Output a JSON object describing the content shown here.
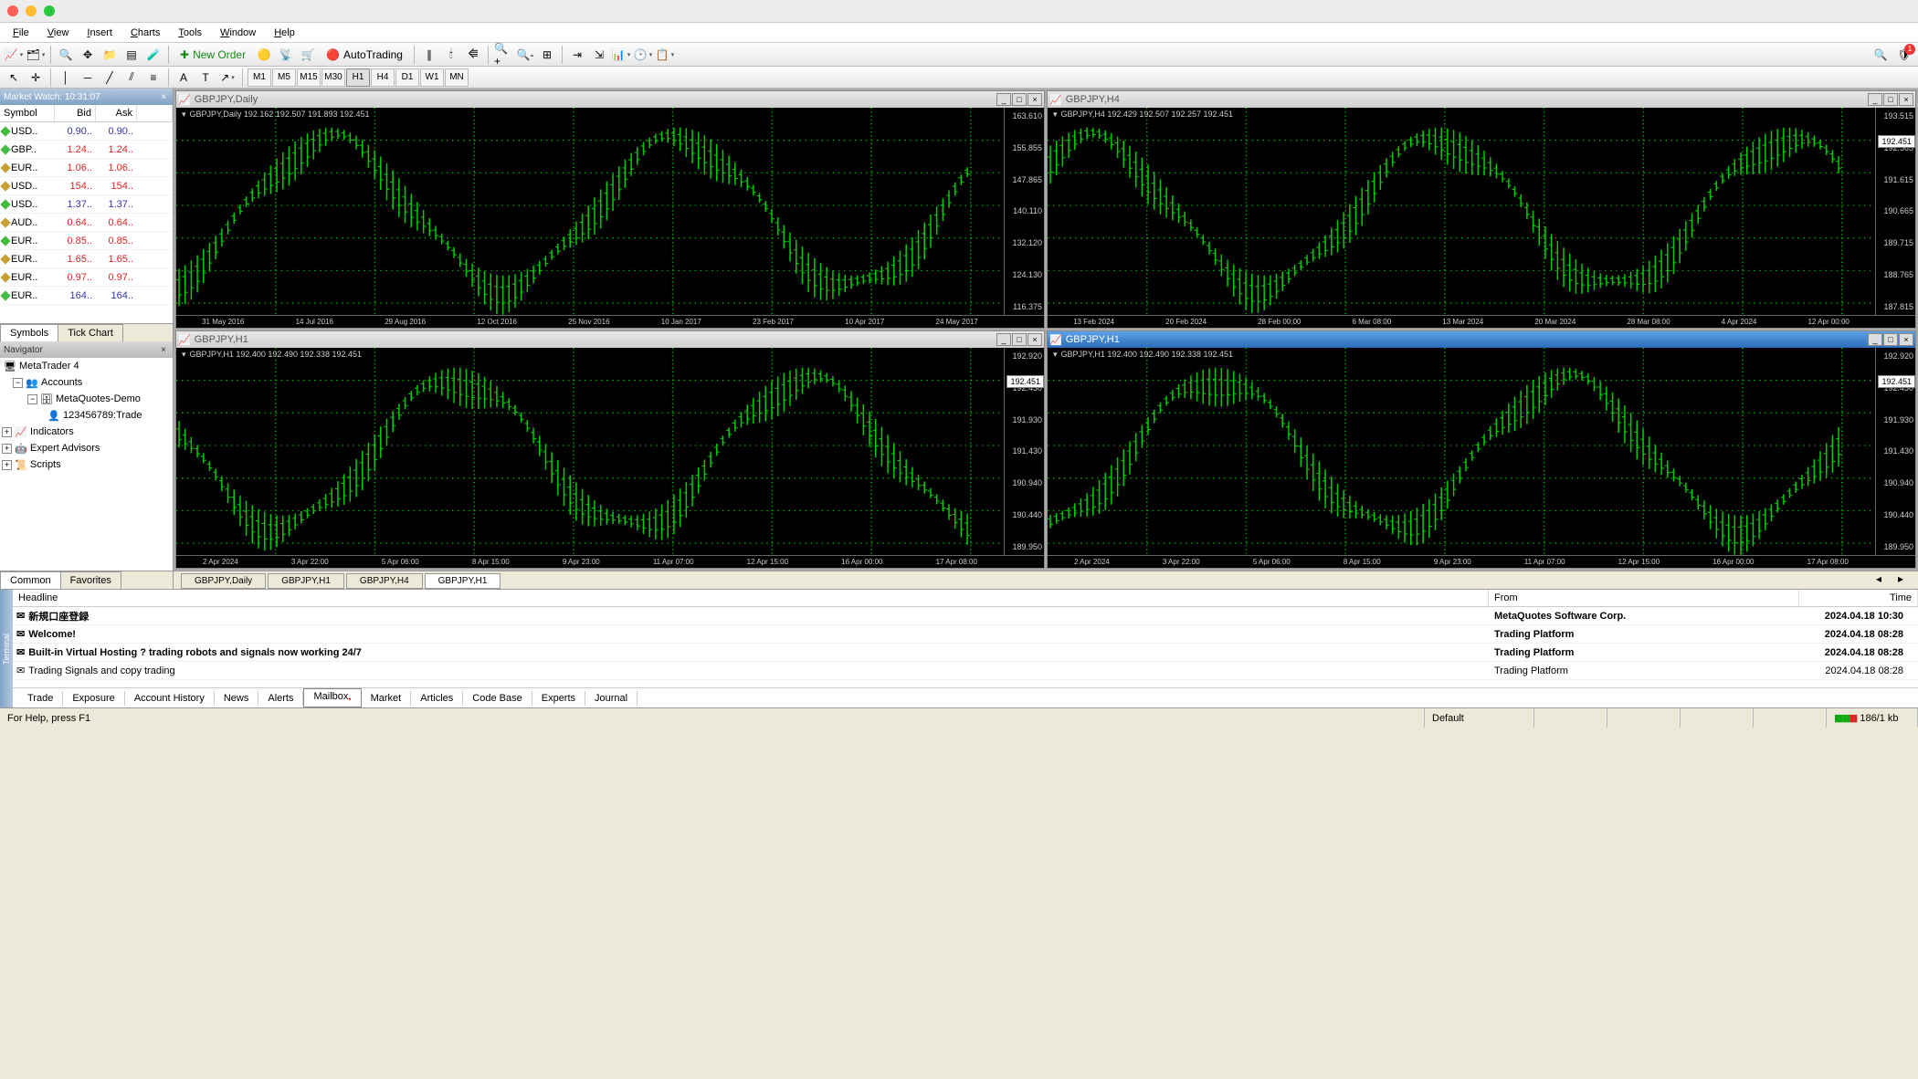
{
  "menu": [
    "File",
    "View",
    "Insert",
    "Charts",
    "Tools",
    "Window",
    "Help"
  ],
  "toolbar": {
    "new_order": "New Order",
    "autotrading": "AutoTrading",
    "notif_count": "1"
  },
  "timeframes": [
    "M1",
    "M5",
    "M15",
    "M30",
    "H1",
    "H4",
    "D1",
    "W1",
    "MN"
  ],
  "tf_active": "H1",
  "market_watch": {
    "title": "Market Watch: 10:31:07",
    "cols": [
      "Symbol",
      "Bid",
      "Ask"
    ],
    "rows": [
      {
        "sym": "USD..",
        "bid": "0.90..",
        "ask": "0.90..",
        "cb": "#33a",
        "ca": "#33a",
        "d": "#4b4"
      },
      {
        "sym": "GBP..",
        "bid": "1.24..",
        "ask": "1.24..",
        "cb": "#d22",
        "ca": "#d22",
        "d": "#4b4"
      },
      {
        "sym": "EUR..",
        "bid": "1.06..",
        "ask": "1.06..",
        "cb": "#d22",
        "ca": "#d22",
        "d": "#c8a030"
      },
      {
        "sym": "USD..",
        "bid": "154..",
        "ask": "154..",
        "cb": "#d22",
        "ca": "#d22",
        "d": "#c8a030"
      },
      {
        "sym": "USD..",
        "bid": "1.37..",
        "ask": "1.37..",
        "cb": "#33a",
        "ca": "#33a",
        "d": "#4b4"
      },
      {
        "sym": "AUD..",
        "bid": "0.64..",
        "ask": "0.64..",
        "cb": "#d22",
        "ca": "#d22",
        "d": "#c8a030"
      },
      {
        "sym": "EUR..",
        "bid": "0.85..",
        "ask": "0.85..",
        "cb": "#d22",
        "ca": "#d22",
        "d": "#4b4"
      },
      {
        "sym": "EUR..",
        "bid": "1.65..",
        "ask": "1.65..",
        "cb": "#d22",
        "ca": "#d22",
        "d": "#c8a030"
      },
      {
        "sym": "EUR..",
        "bid": "0.97..",
        "ask": "0.97..",
        "cb": "#d22",
        "ca": "#d22",
        "d": "#c8a030"
      },
      {
        "sym": "EUR..",
        "bid": "164..",
        "ask": "164..",
        "cb": "#33a",
        "ca": "#33a",
        "d": "#4b4"
      }
    ],
    "tabs": [
      "Symbols",
      "Tick Chart"
    ]
  },
  "navigator": {
    "title": "Navigator",
    "root": "MetaTrader 4",
    "accounts": "Accounts",
    "demo": "MetaQuotes-Demo",
    "user": "123456789:Trade",
    "indicators": "Indicators",
    "experts": "Expert Advisors",
    "scripts": "Scripts",
    "tabs": [
      "Common",
      "Favorites"
    ]
  },
  "charts_list": [
    {
      "title": "GBPJPY,Daily",
      "label": "GBPJPY,Daily  192.162 192.507 191.893 192.451",
      "ylabels": [
        "163.610",
        "155.855",
        "147.865",
        "140.110",
        "132.120",
        "124.130",
        "116.375"
      ],
      "xlabels": [
        "31 May 2016",
        "14 Jul 2016",
        "29 Aug 2016",
        "12 Oct 2016",
        "25 Nov 2016",
        "10 Jan 2017",
        "23 Feb 2017",
        "10 Apr 2017",
        "24 May 2017"
      ],
      "active": false
    },
    {
      "title": "GBPJPY,H4",
      "label": "GBPJPY,H4  192.429 192.507 192.257 192.451",
      "ylabels": [
        "193.515",
        "192.565",
        "191.615",
        "190.665",
        "189.715",
        "188.765",
        "187.815"
      ],
      "tag": "192.451",
      "xlabels": [
        "13 Feb 2024",
        "20 Feb 2024",
        "28 Feb 00:00",
        "6 Mar 08:00",
        "13 Mar 2024",
        "20 Mar 2024",
        "28 Mar 08:00",
        "4 Apr 2024",
        "12 Apr 00:00"
      ],
      "active": false
    },
    {
      "title": "GBPJPY,H1",
      "label": "GBPJPY,H1  192.400 192.490 192.338 192.451",
      "ylabels": [
        "192.920",
        "192.430",
        "191.930",
        "191.430",
        "190.940",
        "190.440",
        "189.950"
      ],
      "tag": "192.451",
      "xlabels": [
        "2 Apr 2024",
        "3 Apr 22:00",
        "5 Apr 06:00",
        "8 Apr 15:00",
        "9 Apr 23:00",
        "11 Apr 07:00",
        "12 Apr 15:00",
        "16 Apr 00:00",
        "17 Apr 08:00"
      ],
      "active": false
    },
    {
      "title": "GBPJPY,H1",
      "label": "GBPJPY,H1  192.400 192.490 192.338 192.451",
      "ylabels": [
        "192.920",
        "192.430",
        "191.930",
        "191.430",
        "190.940",
        "190.440",
        "189.950"
      ],
      "tag": "192.451",
      "xlabels": [
        "2 Apr 2024",
        "3 Apr 22:00",
        "5 Apr 06:00",
        "8 Apr 15:00",
        "9 Apr 23:00",
        "11 Apr 07:00",
        "12 Apr 15:00",
        "16 Apr 00:00",
        "17 Apr 08:00"
      ],
      "active": true
    }
  ],
  "chart_tabs": [
    "GBPJPY,Daily",
    "GBPJPY,H1",
    "GBPJPY,H4",
    "GBPJPY,H1"
  ],
  "chart_tab_active": 3,
  "terminal": {
    "side": "Terminal",
    "cols": [
      "Headline",
      "From",
      "Time"
    ],
    "rows": [
      {
        "h": "新規口座登録",
        "f": "MetaQuotes Software Corp.",
        "t": "2024.04.18 10:30",
        "bold": true
      },
      {
        "h": "Welcome!",
        "f": "Trading Platform",
        "t": "2024.04.18 08:28",
        "bold": true
      },
      {
        "h": "Built-in Virtual Hosting ? trading robots and signals now working 24/7",
        "f": "Trading Platform",
        "t": "2024.04.18 08:28",
        "bold": true
      },
      {
        "h": "Trading Signals and copy trading",
        "f": "Trading Platform",
        "t": "2024.04.18 08:28",
        "bold": false
      }
    ],
    "tabs": [
      "Trade",
      "Exposure",
      "Account History",
      "News",
      "Alerts",
      "Mailbox",
      "Market",
      "Articles",
      "Code Base",
      "Experts",
      "Journal"
    ],
    "tab_active": 5
  },
  "status": {
    "help": "For Help, press F1",
    "profile": "Default",
    "conn": "186/1 kb"
  },
  "chart_data": [
    {
      "type": "bar",
      "title": "GBPJPY,Daily",
      "ylim": [
        116,
        164
      ],
      "x": "31 May 2016 – 24 May 2017",
      "ohlc": [
        192.162,
        192.507,
        191.893,
        192.451
      ]
    },
    {
      "type": "bar",
      "title": "GBPJPY,H4",
      "ylim": [
        187.8,
        193.5
      ],
      "x": "13 Feb 2024 – 12 Apr 2024",
      "ohlc": [
        192.429,
        192.507,
        192.257,
        192.451
      ]
    },
    {
      "type": "bar",
      "title": "GBPJPY,H1",
      "ylim": [
        189.95,
        192.92
      ],
      "x": "2 Apr 2024 – 17 Apr 2024",
      "ohlc": [
        192.4,
        192.49,
        192.338,
        192.451
      ]
    },
    {
      "type": "bar",
      "title": "GBPJPY,H1",
      "ylim": [
        189.95,
        192.92
      ],
      "x": "2 Apr 2024 – 17 Apr 2024",
      "ohlc": [
        192.4,
        192.49,
        192.338,
        192.451
      ]
    }
  ]
}
